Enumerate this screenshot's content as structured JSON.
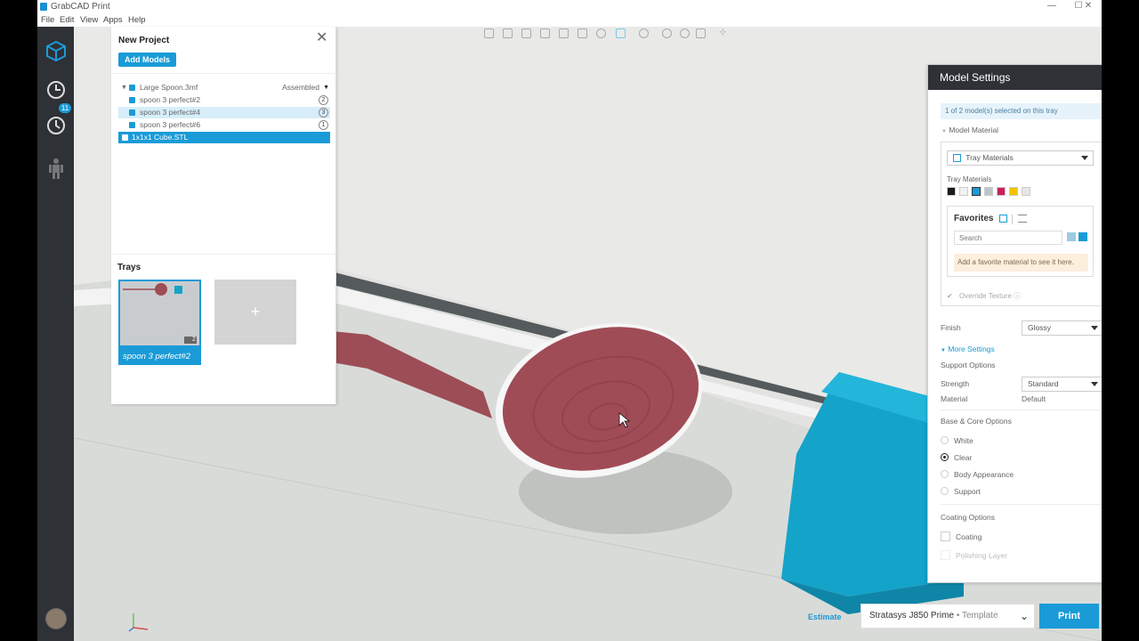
{
  "window": {
    "title": "GrabCAD Print",
    "min": "—",
    "max": "☐",
    "close": "✕"
  },
  "menu": [
    "File",
    "Edit",
    "View",
    "Apps",
    "Help"
  ],
  "sidebar": {
    "badge": "11"
  },
  "project": {
    "title": "New Project",
    "add_models": "Add Models",
    "tree": [
      {
        "label": "Large Spoon.3mf",
        "right": "Assembled"
      },
      {
        "label": "spoon 3 perfect#2",
        "num": "2"
      },
      {
        "label": "spoon 3 perfect#4",
        "num": "3"
      },
      {
        "label": "spoon 3 perfect#6",
        "num": "1"
      },
      {
        "label": "1x1x1 Cube.STL"
      }
    ],
    "trays_title": "Trays",
    "tray_label": "spoon 3 perfect#2",
    "tray_count": "2",
    "add_tray": "+"
  },
  "settings": {
    "title": "Model Settings",
    "selected_info": "1 of 2 model(s) selected on this tray",
    "model_material": "Model Material",
    "material_select": "Tray Materials",
    "tray_materials_label": "Tray Materials",
    "swatches": [
      "#1a1a1a",
      "#f2f2f2",
      "#1a9bd7",
      "#bfc4c8",
      "#cc1f5a",
      "#f2c200",
      "#e6e6e6"
    ],
    "favorites": "Favorites",
    "search_placeholder": "Search",
    "favorites_hint": "Add a favorite material to see it here.",
    "override_texture": "Override Texture",
    "finish_label": "Finish",
    "finish_value": "Glossy",
    "more_settings": "More Settings",
    "support_options": "Support Options",
    "strength_label": "Strength",
    "strength_value": "Standard",
    "material_label": "Material",
    "material_value": "Default",
    "base_core": "Base & Core Options",
    "base_options": [
      "White",
      "Clear",
      "Body Appearance",
      "Support"
    ],
    "coating_options_title": "Coating Options",
    "coating": "Coating",
    "polishing": "Polishing Layer"
  },
  "bottom": {
    "estimate": "Estimate",
    "printer": "Stratasys J850 Prime",
    "printer_template": "Template",
    "print": "Print"
  }
}
